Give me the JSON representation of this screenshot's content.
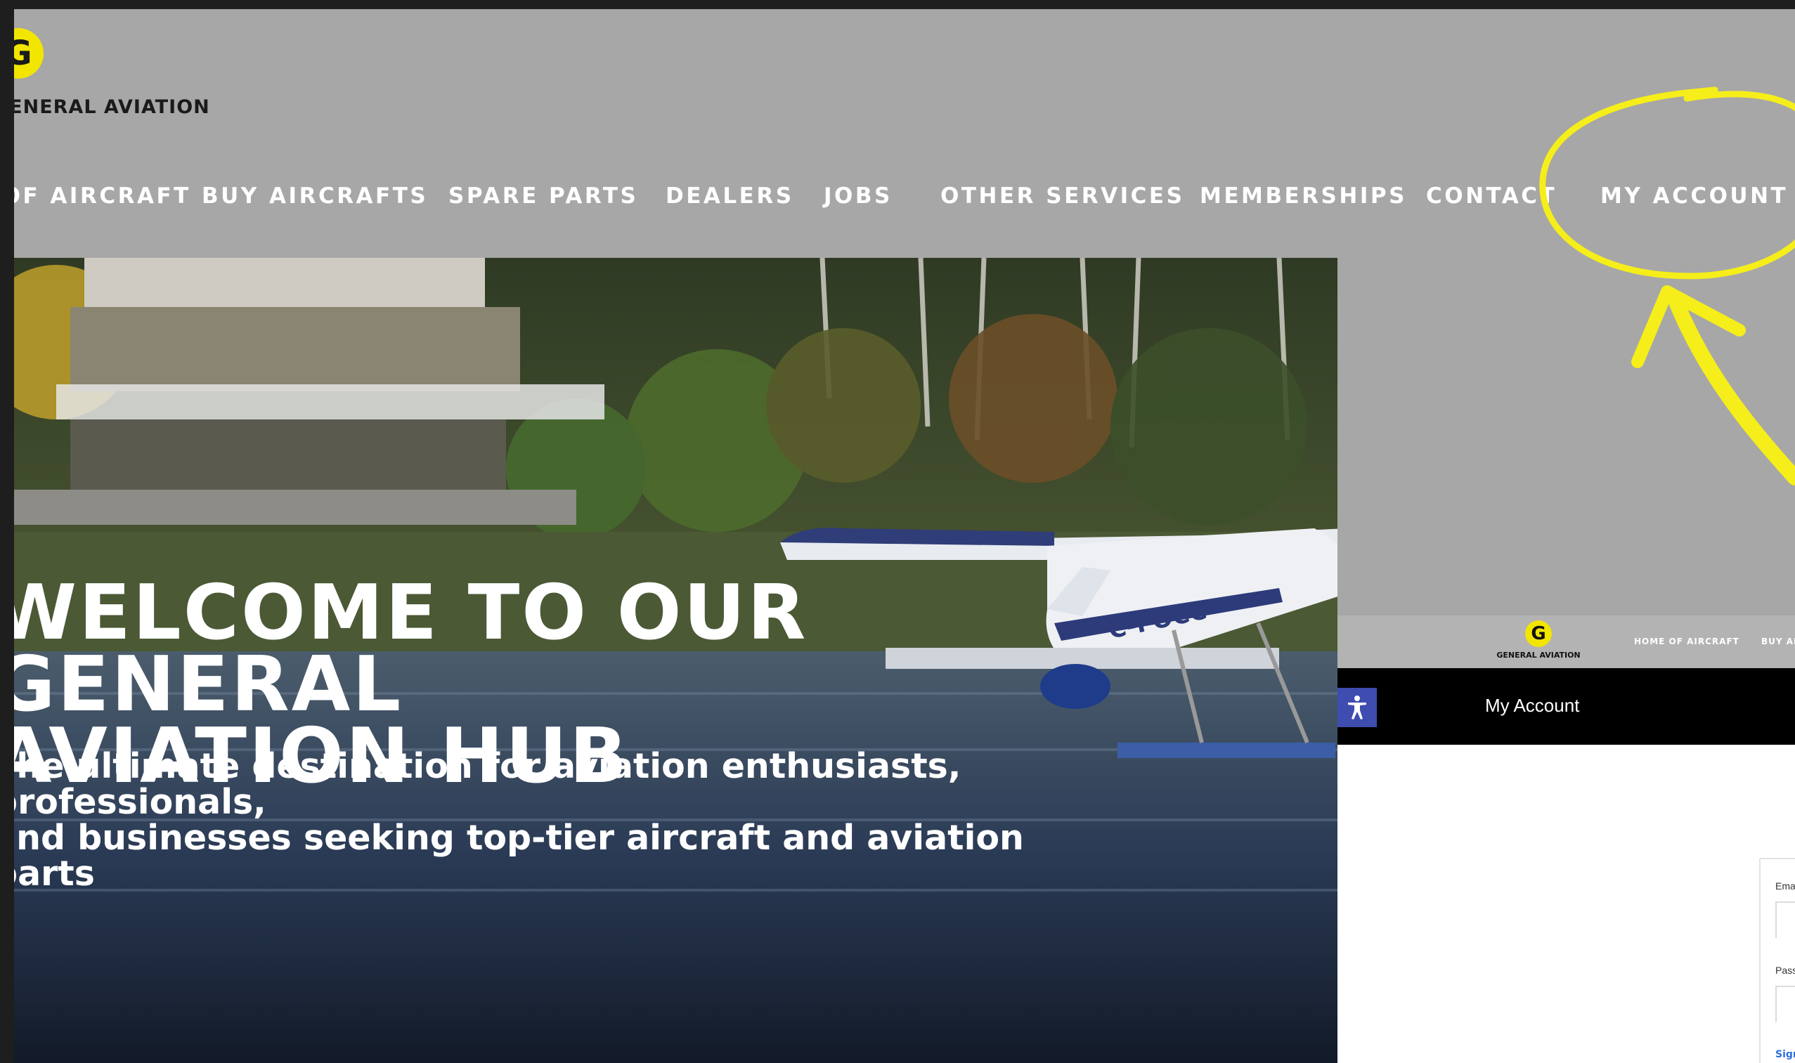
{
  "header": {
    "logo_letter": "G",
    "logo_text": "GENERAL AVIATION",
    "nav": [
      "HOME OF AIRCRAFT",
      "BUY AIRCRAFTS",
      "SPARE PARTS",
      "DEALERS",
      "JOBS",
      "OTHER SERVICES",
      "MEMBERSHIPS",
      "CONTACT",
      "MY ACCOUNT"
    ]
  },
  "hero": {
    "title_line1": "WELCOME TO OUR GENERAL",
    "title_line2": "AVIATION HUB",
    "subtitle_line1": "The ultimate destination for aviation enthusiasts, professionals,",
    "subtitle_line2": "and businesses seeking top-tier aircraft and aviation parts",
    "plane_registration": "C-FOCC"
  },
  "inset": {
    "logo_letter": "G",
    "logo_text": "GENERAL AVIATION",
    "nav": [
      "HOME OF AIRCRAFT",
      "BUY AIRCRAFTS"
    ],
    "page_title": "My Account",
    "form_labels": [
      "Email",
      "Password"
    ],
    "form_link": "Sign in"
  },
  "colors": {
    "header_bg": "#a7a7a7",
    "logo_yellow": "#f2e500",
    "annotation_yellow": "#f5ee1a",
    "inset_bar": "#000000",
    "accessibility_button": "#3f4db0"
  },
  "icons": {
    "accessibility": "accessibility-person-icon"
  }
}
